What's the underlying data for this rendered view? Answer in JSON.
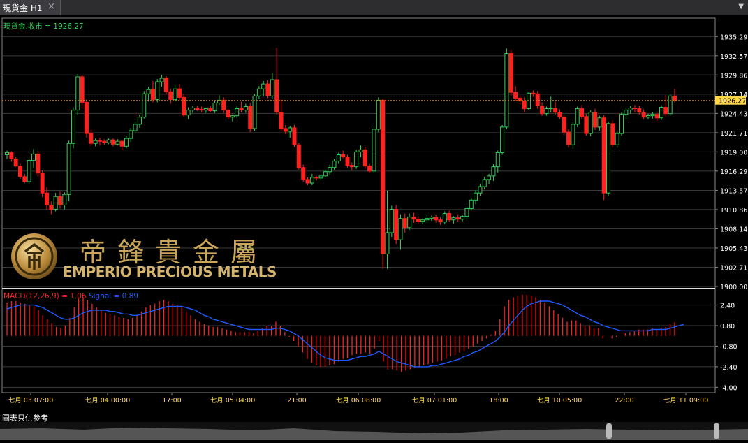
{
  "tab": {
    "title": "現貨金 H1",
    "close_glyph": "×",
    "menu_glyph": "▼"
  },
  "price_panel": {
    "title": "現貨金.收市 = 1926.27",
    "current_price": "1926.27"
  },
  "macd_panel": {
    "macd_label": "MACD(12,26,9) = 1.06",
    "signal_label": "Signal = 0.89"
  },
  "watermark": {
    "chinese": "帝鋒貴金屬",
    "english": "EMPERIO PRECIOUS METALS",
    "emblem": "coin-emblem-icon"
  },
  "footer": {
    "label": "圖表只供參考"
  },
  "colors": {
    "up": "#34d058",
    "down": "#ff2020",
    "signal": "#1e5bff",
    "current": "#ffd84a",
    "grid": "#3a3a3a"
  },
  "chart_data": [
    {
      "type": "candlestick",
      "title": "現貨金.收市 = 1926.27",
      "y_ticks": [
        "1935.29",
        "1932.57",
        "1929.86",
        "1927.14",
        "1924.43",
        "1921.71",
        "1919.00",
        "1916.29",
        "1913.57",
        "1910.86",
        "1908.14",
        "1905.43",
        "1902.71",
        "1900.00"
      ],
      "x_ticks": [
        "七月 03 07:00",
        "七月 04 00:00",
        "17:00",
        "七月 05 04:00",
        "21:00",
        "七月 06 08:00",
        "七月 07 01:00",
        "18:00",
        "七月 10 05:00",
        "22:00",
        "七月 11 09:00"
      ],
      "ylim": [
        1900.0,
        1936.5
      ],
      "current_price": 1926.27,
      "candles": [
        [
          1918.6,
          1919.2,
          1918.0,
          1918.9
        ],
        [
          1918.9,
          1919.1,
          1917.6,
          1918.0
        ],
        [
          1918.0,
          1918.3,
          1916.9,
          1917.0
        ],
        [
          1917.0,
          1917.4,
          1915.2,
          1915.5
        ],
        [
          1915.5,
          1915.9,
          1914.6,
          1914.8
        ],
        [
          1914.8,
          1918.2,
          1914.5,
          1917.8
        ],
        [
          1917.8,
          1919.4,
          1916.8,
          1918.7
        ],
        [
          1918.7,
          1919.1,
          1915.5,
          1916.0
        ],
        [
          1916.0,
          1916.4,
          1912.6,
          1913.2
        ],
        [
          1913.2,
          1914.0,
          1910.8,
          1911.5
        ],
        [
          1911.5,
          1912.0,
          1910.2,
          1910.9
        ],
        [
          1910.9,
          1913.2,
          1910.6,
          1912.7
        ],
        [
          1912.7,
          1913.4,
          1911.0,
          1911.5
        ],
        [
          1911.5,
          1913.3,
          1910.9,
          1913.0
        ],
        [
          1913.0,
          1920.6,
          1912.0,
          1920.2
        ],
        [
          1920.2,
          1925.3,
          1919.5,
          1924.9
        ],
        [
          1924.9,
          1930.0,
          1924.2,
          1929.6
        ],
        [
          1929.6,
          1929.9,
          1925.1,
          1926.0
        ],
        [
          1926.0,
          1926.4,
          1921.0,
          1921.6
        ],
        [
          1921.6,
          1922.1,
          1919.8,
          1920.2
        ],
        [
          1920.2,
          1920.9,
          1919.8,
          1920.6
        ],
        [
          1920.6,
          1921.0,
          1919.9,
          1920.5
        ],
        [
          1920.5,
          1920.8,
          1920.0,
          1920.3
        ],
        [
          1920.3,
          1920.9,
          1920.1,
          1920.7
        ],
        [
          1920.7,
          1920.9,
          1919.8,
          1920.1
        ],
        [
          1920.1,
          1920.8,
          1919.9,
          1920.5
        ],
        [
          1920.5,
          1920.6,
          1919.2,
          1919.8
        ],
        [
          1919.8,
          1921.3,
          1919.5,
          1920.9
        ],
        [
          1920.9,
          1922.4,
          1920.4,
          1922.0
        ],
        [
          1922.0,
          1923.3,
          1921.6,
          1922.9
        ],
        [
          1922.9,
          1924.3,
          1922.4,
          1923.9
        ],
        [
          1923.9,
          1927.6,
          1923.7,
          1927.2
        ],
        [
          1927.2,
          1928.2,
          1926.1,
          1927.8
        ],
        [
          1927.8,
          1929.0,
          1926.0,
          1926.4
        ],
        [
          1926.4,
          1929.3,
          1926.0,
          1928.9
        ],
        [
          1928.9,
          1929.9,
          1928.2,
          1929.4
        ],
        [
          1929.4,
          1929.7,
          1927.1,
          1927.5
        ],
        [
          1927.5,
          1927.9,
          1925.8,
          1926.4
        ],
        [
          1926.4,
          1928.5,
          1926.2,
          1927.9
        ],
        [
          1927.9,
          1928.6,
          1926.3,
          1926.7
        ],
        [
          1926.7,
          1927.2,
          1923.9,
          1924.2
        ],
        [
          1924.2,
          1925.3,
          1923.6,
          1924.9
        ],
        [
          1924.9,
          1925.5,
          1924.5,
          1925.2
        ],
        [
          1925.2,
          1925.5,
          1924.8,
          1925.0
        ],
        [
          1925.0,
          1925.4,
          1924.6,
          1924.9
        ],
        [
          1924.9,
          1925.2,
          1924.5,
          1925.1
        ],
        [
          1925.1,
          1925.5,
          1924.6,
          1924.8
        ],
        [
          1924.8,
          1926.2,
          1924.5,
          1925.9
        ],
        [
          1925.9,
          1927.0,
          1925.6,
          1926.3
        ],
        [
          1926.3,
          1926.7,
          1924.5,
          1924.9
        ],
        [
          1924.9,
          1925.1,
          1923.6,
          1923.9
        ],
        [
          1923.9,
          1924.3,
          1923.3,
          1924.1
        ],
        [
          1924.1,
          1925.5,
          1923.8,
          1925.1
        ],
        [
          1925.1,
          1926.1,
          1924.6,
          1924.9
        ],
        [
          1924.9,
          1925.8,
          1924.5,
          1925.4
        ],
        [
          1925.4,
          1925.9,
          1921.8,
          1922.3
        ],
        [
          1922.3,
          1927.2,
          1922.0,
          1926.9
        ],
        [
          1926.9,
          1928.3,
          1926.5,
          1927.9
        ],
        [
          1927.9,
          1929.0,
          1926.8,
          1928.6
        ],
        [
          1928.6,
          1929.1,
          1926.6,
          1926.9
        ],
        [
          1926.9,
          1930.2,
          1926.5,
          1929.2
        ],
        [
          1929.2,
          1933.7,
          1924.2,
          1924.6
        ],
        [
          1924.6,
          1926.4,
          1922.0,
          1922.3
        ],
        [
          1922.3,
          1922.8,
          1921.5,
          1921.9
        ],
        [
          1921.9,
          1922.7,
          1921.0,
          1922.4
        ],
        [
          1922.4,
          1922.8,
          1919.7,
          1920.0
        ],
        [
          1920.0,
          1920.3,
          1916.5,
          1916.8
        ],
        [
          1916.8,
          1917.2,
          1914.8,
          1915.1
        ],
        [
          1915.1,
          1915.4,
          1914.3,
          1914.6
        ],
        [
          1914.6,
          1915.9,
          1914.3,
          1915.4
        ],
        [
          1915.4,
          1915.6,
          1915.0,
          1915.3
        ],
        [
          1915.3,
          1915.8,
          1914.9,
          1915.6
        ],
        [
          1915.6,
          1916.5,
          1915.4,
          1916.2
        ],
        [
          1916.2,
          1917.2,
          1915.7,
          1916.8
        ],
        [
          1916.8,
          1918.0,
          1916.5,
          1917.7
        ],
        [
          1917.7,
          1918.9,
          1917.4,
          1918.6
        ],
        [
          1918.6,
          1919.2,
          1918.1,
          1918.3
        ],
        [
          1918.3,
          1918.6,
          1916.8,
          1917.1
        ],
        [
          1917.1,
          1917.5,
          1916.4,
          1916.9
        ],
        [
          1916.9,
          1919.3,
          1916.6,
          1919.0
        ],
        [
          1919.0,
          1919.9,
          1918.3,
          1919.3
        ],
        [
          1919.3,
          1919.7,
          1916.6,
          1917.0
        ],
        [
          1917.0,
          1917.4,
          1916.1,
          1916.3
        ],
        [
          1916.3,
          1922.6,
          1916.0,
          1922.2
        ],
        [
          1922.2,
          1926.7,
          1921.8,
          1926.3
        ],
        [
          1926.3,
          1926.5,
          1902.5,
          1904.6
        ],
        [
          1904.6,
          1913.5,
          1902.5,
          1907.6
        ],
        [
          1907.6,
          1911.4,
          1907.0,
          1910.9
        ],
        [
          1910.9,
          1911.5,
          1906.0,
          1906.6
        ],
        [
          1906.6,
          1910.2,
          1905.2,
          1909.6
        ],
        [
          1909.6,
          1910.3,
          1907.6,
          1908.3
        ],
        [
          1908.3,
          1910.3,
          1908.0,
          1909.8
        ],
        [
          1909.8,
          1910.4,
          1909.0,
          1909.5
        ],
        [
          1909.5,
          1909.9,
          1908.9,
          1909.2
        ],
        [
          1909.2,
          1909.6,
          1908.8,
          1909.4
        ],
        [
          1909.4,
          1910.1,
          1908.9,
          1909.6
        ],
        [
          1909.6,
          1910.0,
          1909.3,
          1909.8
        ],
        [
          1909.8,
          1910.2,
          1909.0,
          1909.4
        ],
        [
          1909.4,
          1909.8,
          1908.7,
          1909.1
        ],
        [
          1909.1,
          1910.6,
          1908.8,
          1910.3
        ],
        [
          1910.3,
          1910.7,
          1909.1,
          1909.4
        ],
        [
          1909.4,
          1909.9,
          1908.9,
          1909.7
        ],
        [
          1909.7,
          1910.2,
          1909.1,
          1909.5
        ],
        [
          1909.5,
          1910.1,
          1909.2,
          1909.9
        ],
        [
          1909.9,
          1911.3,
          1909.6,
          1911.0
        ],
        [
          1911.0,
          1912.5,
          1910.7,
          1912.2
        ],
        [
          1912.2,
          1913.6,
          1911.6,
          1913.2
        ],
        [
          1913.2,
          1914.5,
          1912.8,
          1914.1
        ],
        [
          1914.1,
          1915.5,
          1913.7,
          1915.1
        ],
        [
          1915.1,
          1915.9,
          1914.4,
          1915.6
        ],
        [
          1915.6,
          1917.3,
          1914.9,
          1916.9
        ],
        [
          1916.9,
          1919.2,
          1916.1,
          1918.9
        ],
        [
          1918.9,
          1922.8,
          1918.6,
          1922.5
        ],
        [
          1922.5,
          1933.6,
          1922.2,
          1932.9
        ],
        [
          1932.9,
          1933.4,
          1926.9,
          1927.4
        ],
        [
          1927.4,
          1928.3,
          1926.2,
          1926.6
        ],
        [
          1926.6,
          1927.0,
          1925.7,
          1926.2
        ],
        [
          1926.2,
          1926.7,
          1924.6,
          1925.1
        ],
        [
          1925.1,
          1927.4,
          1924.9,
          1927.3
        ],
        [
          1927.3,
          1927.7,
          1926.8,
          1927.2
        ],
        [
          1927.2,
          1927.6,
          1925.1,
          1925.5
        ],
        [
          1925.5,
          1926.0,
          1924.1,
          1924.4
        ],
        [
          1924.4,
          1925.4,
          1924.1,
          1925.1
        ],
        [
          1925.1,
          1926.8,
          1924.6,
          1925.2
        ],
        [
          1925.2,
          1926.1,
          1924.3,
          1924.6
        ],
        [
          1924.6,
          1925.0,
          1923.6,
          1923.9
        ],
        [
          1923.9,
          1924.3,
          1921.4,
          1921.8
        ],
        [
          1921.8,
          1922.2,
          1919.6,
          1920.0
        ],
        [
          1920.0,
          1923.2,
          1919.4,
          1922.9
        ],
        [
          1922.9,
          1925.4,
          1922.5,
          1925.1
        ],
        [
          1925.1,
          1925.6,
          1923.6,
          1924.0
        ],
        [
          1924.0,
          1924.4,
          1921.3,
          1921.6
        ],
        [
          1921.6,
          1924.9,
          1921.2,
          1924.6
        ],
        [
          1924.6,
          1925.1,
          1922.1,
          1922.5
        ],
        [
          1922.5,
          1924.1,
          1922.0,
          1923.8
        ],
        [
          1923.8,
          1924.2,
          1912.2,
          1913.2
        ],
        [
          1913.2,
          1923.3,
          1912.8,
          1923.0
        ],
        [
          1923.0,
          1923.5,
          1919.6,
          1920.0
        ],
        [
          1920.0,
          1921.9,
          1919.6,
          1921.6
        ],
        [
          1921.6,
          1924.6,
          1921.3,
          1924.3
        ],
        [
          1924.3,
          1925.3,
          1923.6,
          1924.9
        ],
        [
          1924.9,
          1925.5,
          1924.4,
          1925.2
        ],
        [
          1925.2,
          1925.6,
          1924.6,
          1925.1
        ],
        [
          1925.1,
          1925.5,
          1924.3,
          1924.6
        ],
        [
          1924.6,
          1925.0,
          1923.6,
          1923.9
        ],
        [
          1923.9,
          1924.4,
          1923.6,
          1924.1
        ],
        [
          1924.1,
          1924.6,
          1923.7,
          1924.3
        ],
        [
          1924.3,
          1924.7,
          1923.4,
          1923.8
        ],
        [
          1923.8,
          1925.6,
          1923.5,
          1925.3
        ],
        [
          1925.3,
          1927.0,
          1924.0,
          1924.4
        ],
        [
          1924.4,
          1927.2,
          1924.1,
          1926.9
        ],
        [
          1926.9,
          1927.9,
          1926.0,
          1926.27
        ]
      ]
    },
    {
      "type": "bar",
      "title": "MACD(12,26,9) = 1.06",
      "series_names": [
        "MACD",
        "Signal"
      ],
      "y_ticks": [
        "2.40",
        "0.80",
        "-0.80",
        "-2.40",
        "-4.00"
      ],
      "ylim": [
        -4.2,
        3.3
      ],
      "macd": [
        2.6,
        2.7,
        2.7,
        2.6,
        2.5,
        2.4,
        2.3,
        2.0,
        1.6,
        1.3,
        1.0,
        0.7,
        0.6,
        0.8,
        1.4,
        2.2,
        2.9,
        3.0,
        2.8,
        2.5,
        2.2,
        2.0,
        1.8,
        1.7,
        1.6,
        1.5,
        1.4,
        1.3,
        1.4,
        1.6,
        1.9,
        2.2,
        2.4,
        2.5,
        2.7,
        2.8,
        2.7,
        2.5,
        2.4,
        2.2,
        1.9,
        1.6,
        1.3,
        1.1,
        0.9,
        0.8,
        0.7,
        0.7,
        0.6,
        0.5,
        0.4,
        0.3,
        0.3,
        0.3,
        0.3,
        0.2,
        0.4,
        0.6,
        0.8,
        0.8,
        1.1,
        0.8,
        0.3,
        -0.1,
        -0.4,
        -0.8,
        -1.3,
        -1.8,
        -2.1,
        -2.3,
        -2.4,
        -2.4,
        -2.3,
        -2.2,
        -2.0,
        -1.8,
        -1.7,
        -1.5,
        -1.4,
        -1.4,
        -1.3,
        -1.4,
        -1.0,
        -0.4,
        -2.0,
        -2.6,
        -2.6,
        -2.7,
        -2.8,
        -2.7,
        -2.6,
        -2.5,
        -2.4,
        -2.3,
        -2.2,
        -2.1,
        -2.0,
        -1.9,
        -1.8,
        -1.6,
        -1.5,
        -1.3,
        -1.2,
        -1.0,
        -0.8,
        -0.6,
        -0.4,
        -0.2,
        0.1,
        0.4,
        1.3,
        2.3,
        2.8,
        3.0,
        3.1,
        3.2,
        3.2,
        3.1,
        3.0,
        2.8,
        2.6,
        2.3,
        2.0,
        1.7,
        1.4,
        1.1,
        1.2,
        1.2,
        1.0,
        0.8,
        0.8,
        0.6,
        0.6,
        -0.2,
        0.0,
        -0.2,
        -0.1,
        0.0,
        0.2,
        0.3,
        0.4,
        0.5,
        0.5,
        0.5,
        0.6,
        0.5,
        0.6,
        0.7,
        0.9,
        1.06
      ],
      "signal": [
        2.1,
        2.2,
        2.3,
        2.4,
        2.4,
        2.4,
        2.4,
        2.3,
        2.2,
        2.0,
        1.8,
        1.6,
        1.4,
        1.3,
        1.3,
        1.4,
        1.6,
        1.8,
        1.9,
        2.0,
        2.0,
        2.0,
        2.0,
        1.9,
        1.9,
        1.8,
        1.7,
        1.7,
        1.6,
        1.6,
        1.7,
        1.8,
        1.9,
        2.0,
        2.1,
        2.2,
        2.3,
        2.3,
        2.3,
        2.3,
        2.2,
        2.1,
        2.0,
        1.8,
        1.6,
        1.5,
        1.3,
        1.2,
        1.1,
        1.0,
        0.9,
        0.8,
        0.7,
        0.6,
        0.5,
        0.5,
        0.5,
        0.5,
        0.5,
        0.5,
        0.6,
        0.6,
        0.5,
        0.4,
        0.2,
        0.0,
        -0.3,
        -0.6,
        -0.9,
        -1.2,
        -1.5,
        -1.7,
        -1.8,
        -1.9,
        -1.9,
        -1.9,
        -1.9,
        -1.8,
        -1.7,
        -1.6,
        -1.6,
        -1.5,
        -1.4,
        -1.2,
        -1.4,
        -1.6,
        -1.8,
        -2.0,
        -2.1,
        -2.2,
        -2.3,
        -2.4,
        -2.4,
        -2.4,
        -2.4,
        -2.3,
        -2.3,
        -2.2,
        -2.1,
        -2.0,
        -1.9,
        -1.8,
        -1.6,
        -1.5,
        -1.3,
        -1.2,
        -1.0,
        -0.8,
        -0.6,
        -0.4,
        -0.1,
        0.3,
        0.8,
        1.2,
        1.6,
        2.0,
        2.3,
        2.5,
        2.6,
        2.7,
        2.7,
        2.7,
        2.6,
        2.5,
        2.4,
        2.2,
        2.0,
        1.8,
        1.6,
        1.5,
        1.3,
        1.1,
        1.0,
        0.8,
        0.7,
        0.6,
        0.5,
        0.4,
        0.4,
        0.4,
        0.4,
        0.4,
        0.4,
        0.4,
        0.5,
        0.5,
        0.5,
        0.5,
        0.6,
        0.7,
        0.8,
        0.89
      ]
    }
  ]
}
